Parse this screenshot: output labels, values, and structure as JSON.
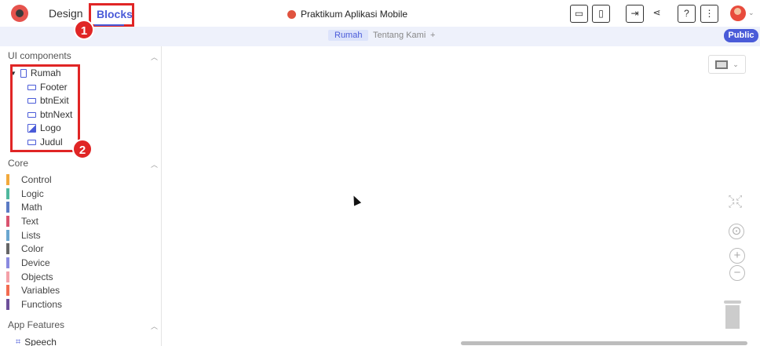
{
  "header": {
    "tab_design": "Design",
    "tab_blocks": "Blocks",
    "project_title": "Praktikum Aplikasi Mobile",
    "toolbar_icons": [
      "preview-icon",
      "phone-preview-icon",
      "export-icon",
      "share-icon",
      "help-icon",
      "more-icon"
    ],
    "help_label": "?",
    "more_label": "⋮"
  },
  "screens": {
    "tabs": [
      "Rumah",
      "Tentang Kami"
    ],
    "add_label": "+",
    "public_label": "Public"
  },
  "sidebar": {
    "ui_components_title": "UI components",
    "tree_root": "Rumah",
    "tree_children": [
      "Footer",
      "btnExit",
      "btnNext",
      "Logo",
      "Judul"
    ],
    "core_title": "Core",
    "core_items": [
      {
        "label": "Control",
        "color": "#f2a93b"
      },
      {
        "label": "Logic",
        "color": "#4fb89e"
      },
      {
        "label": "Math",
        "color": "#5b7bc4"
      },
      {
        "label": "Text",
        "color": "#d9536f"
      },
      {
        "label": "Lists",
        "color": "#6aa6d0"
      },
      {
        "label": "Color",
        "color": "#666666"
      },
      {
        "label": "Device",
        "color": "#8a8ae0"
      },
      {
        "label": "Objects",
        "color": "#f4a0a8"
      },
      {
        "label": "Variables",
        "color": "#f26b4f"
      },
      {
        "label": "Functions",
        "color": "#6d4f9a"
      }
    ],
    "app_features_title": "App Features",
    "app_features_items": [
      "Speech"
    ]
  },
  "annotations": {
    "badge_1": "1",
    "badge_2": "2"
  },
  "colors": {
    "accent": "#4a5bd8",
    "highlight": "#e02525"
  }
}
